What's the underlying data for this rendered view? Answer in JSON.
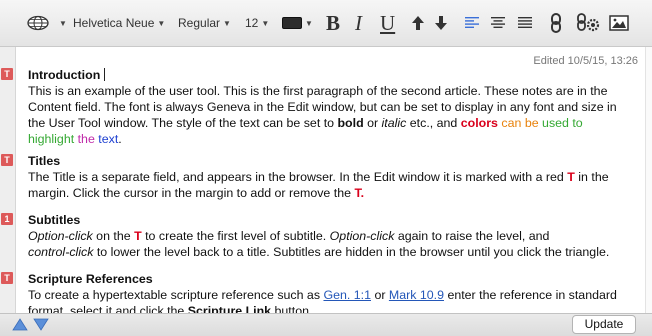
{
  "toolbar": {
    "font_family": "Helvetica Neue",
    "font_style": "Regular",
    "font_size": "12",
    "bold_label": "B",
    "italic_label": "I",
    "underline_label": "U"
  },
  "document": {
    "edited": "Edited 10/5/15, 13:26",
    "marker_letters": [
      "T",
      "T",
      "1",
      "T"
    ],
    "intro": {
      "title": "Introduction",
      "body_1": "This is an example of the user tool. This is the first paragraph of the second article. These notes are in the Content field. The font is always Geneva in the Edit window, but can be set to display in any font and size in the User Tool window. The style of the text can be set to ",
      "bold": "bold",
      "or": " or ",
      "italic": "italic",
      "etc": " etc., and ",
      "colors": "colors",
      "can": " can",
      "be": " be",
      "used_to": " used to",
      "highlight": "highlight",
      "the": " the",
      "text": " text",
      "period": "."
    },
    "titles": {
      "title": "Titles",
      "body_1": "The Title is a separate field, and appears in the browser. In the Edit window it is marked with a red ",
      "t": "T",
      "body_2": " in the margin. Click the cursor in the margin to add or remove the ",
      "t2": "T.",
      "end": ""
    },
    "subtitles": {
      "title": "Subtitles",
      "opt_click": "Option-click",
      "on_the": " on the ",
      "t": "T",
      "body_1": " to create the first level of subtitle. ",
      "opt_click2": "Option-click",
      "body_2": " again to raise the level, and ",
      "ctrl_click": "control-click",
      "body_3": " to lower the level back to a title. Subtitles are hidden in the browser until you click the triangle."
    },
    "scripture": {
      "title": "Scripture References",
      "body_1": "To create a hypertextable scripture reference such as ",
      "ref1": "Gen. 1:1",
      "or": " or ",
      "ref2": "Mark 10.9",
      "body_2": " enter the reference in standard format, select it and click the ",
      "link_label": "Scripture Link",
      "body_3": " button."
    }
  },
  "bottom": {
    "update_label": "Update"
  },
  "colors": {
    "marker": "#dd5a5a",
    "red_text": "#d9001b",
    "link": "#2457b8",
    "align_left_active": "#3a6fd8"
  }
}
